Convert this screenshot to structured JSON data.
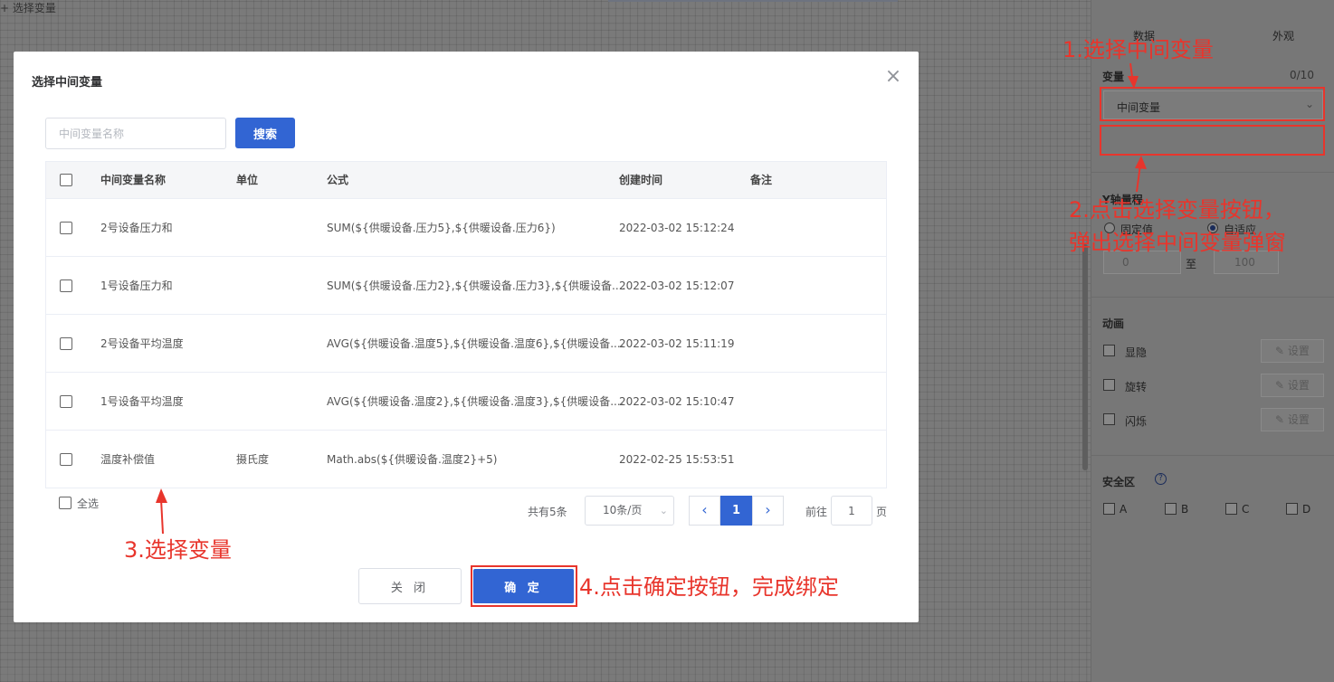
{
  "right_panel": {
    "data_tab": "数据",
    "appearance_tab": "外观",
    "variable_label": "变量",
    "variable_count": "0/10",
    "variable_select_value": "中间变量",
    "select_variable_button": "+ 选择变量",
    "y_range_label": "Y轴量程",
    "radio_fixed": "固定值",
    "radio_auto": "自适应",
    "range_min": "0",
    "range_to": "至",
    "range_max": "100",
    "animation_label": "动画",
    "animations": [
      {
        "label": "显隐",
        "button": "设置"
      },
      {
        "label": "旋转",
        "button": "设置"
      },
      {
        "label": "闪烁",
        "button": "设置"
      }
    ],
    "safe_zone_label": "安全区",
    "safe_zones": [
      "A",
      "B",
      "C",
      "D"
    ]
  },
  "modal": {
    "title": "选择中间变量",
    "search_placeholder": "中间变量名称",
    "search_button": "搜索",
    "columns": [
      "中间变量名称",
      "单位",
      "公式",
      "创建时间",
      "备注"
    ],
    "rows": [
      {
        "name": "2号设备压力和",
        "unit": "",
        "formula": "SUM(${供暖设备.压力5},${供暖设备.压力6})",
        "created": "2022-03-02 15:12:24",
        "note": ""
      },
      {
        "name": "1号设备压力和",
        "unit": "",
        "formula": "SUM(${供暖设备.压力2},${供暖设备.压力3},${供暖设备....",
        "created": "2022-03-02 15:12:07",
        "note": ""
      },
      {
        "name": "2号设备平均温度",
        "unit": "",
        "formula": "AVG(${供暖设备.温度5},${供暖设备.温度6},${供暖设备....",
        "created": "2022-03-02 15:11:19",
        "note": ""
      },
      {
        "name": "1号设备平均温度",
        "unit": "",
        "formula": "AVG(${供暖设备.温度2},${供暖设备.温度3},${供暖设备....",
        "created": "2022-03-02 15:10:47",
        "note": ""
      },
      {
        "name": "温度补偿值",
        "unit": "摄氏度",
        "formula": "Math.abs(${供暖设备.温度2}+5)",
        "created": "2022-02-25 15:53:51",
        "note": ""
      }
    ],
    "select_all": "全选",
    "pagination": {
      "total": "共有5条",
      "page_size": "10条/页",
      "current_page": "1",
      "goto_prefix": "前往",
      "goto_value": "1",
      "goto_suffix": "页"
    },
    "close_button": "关 闭",
    "confirm_button": "确 定"
  },
  "annotations": {
    "step1": "1.选择中间变量",
    "step2_line1": "2.点击选择变量按钮，",
    "step2_line2": "弹出选择中间变量弹窗",
    "step3": "3.选择变量",
    "step4": "4.点击确定按钮，完成绑定"
  },
  "colors": {
    "primary": "#3265d3",
    "annotation_red": "#e8352c"
  }
}
